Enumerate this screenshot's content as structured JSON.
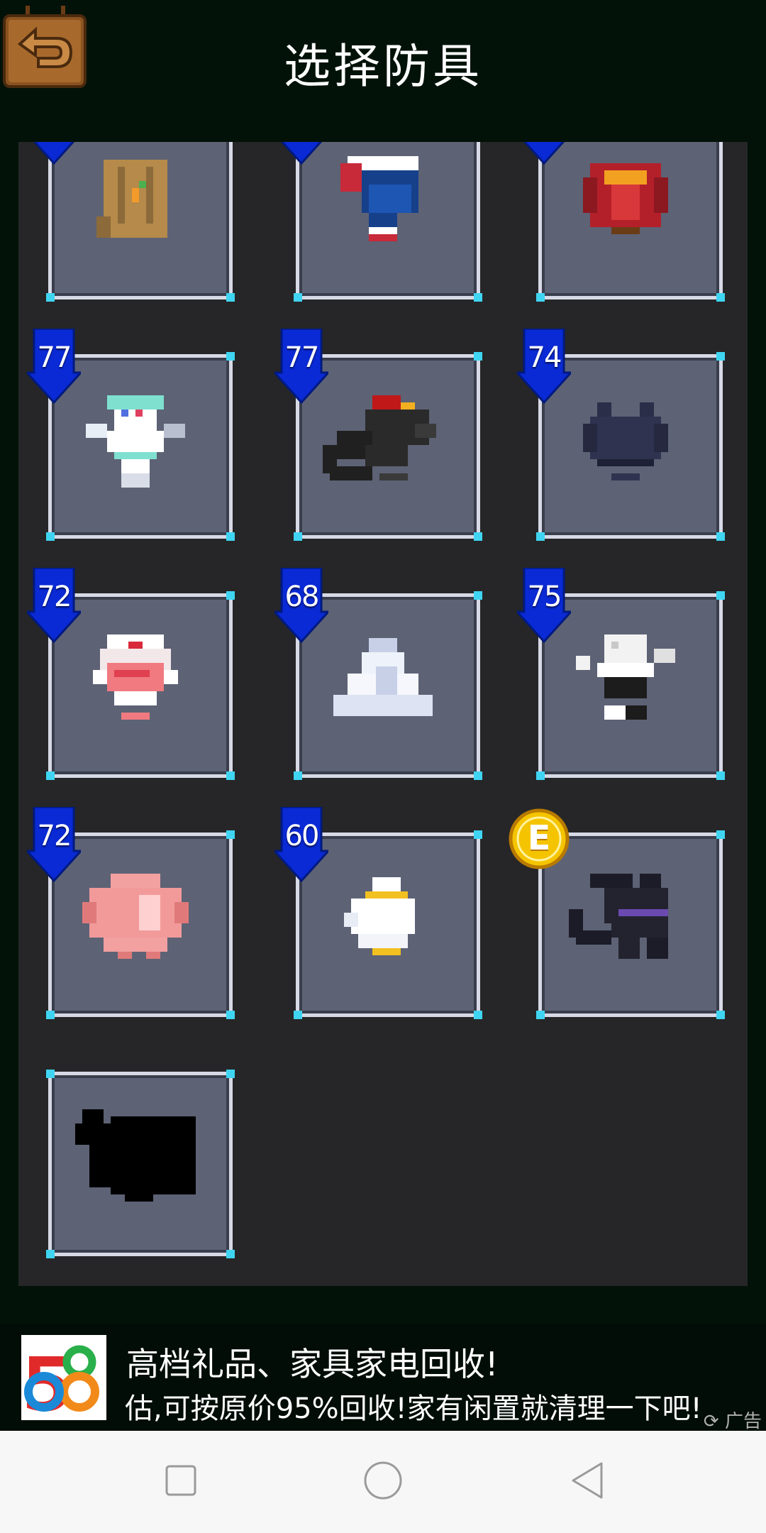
{
  "header": {
    "title": "选择防具",
    "back_icon": "back-arrow-icon"
  },
  "armors": [
    {
      "sprite": "tan-vest-armor-icon",
      "badge": ""
    },
    {
      "sprite": "blue-cape-armor-icon",
      "badge": ""
    },
    {
      "sprite": "red-mage-armor-icon",
      "badge": ""
    },
    {
      "sprite": "white-mech-armor-icon",
      "badge": "77"
    },
    {
      "sprite": "black-dragon-armor-icon",
      "badge": "77"
    },
    {
      "sprite": "dark-slime-armor-icon",
      "badge": "74"
    },
    {
      "sprite": "pink-maid-armor-icon",
      "badge": "72"
    },
    {
      "sprite": "white-snow-armor-icon",
      "badge": "68"
    },
    {
      "sprite": "white-robot-armor-icon",
      "badge": "75"
    },
    {
      "sprite": "pink-pig-armor-icon",
      "badge": "72"
    },
    {
      "sprite": "white-cloud-armor-icon",
      "badge": "60"
    },
    {
      "sprite": "dark-bat-armor-icon",
      "badge": "E"
    },
    {
      "sprite": "locked-silhouette-armor-icon",
      "badge": ""
    }
  ],
  "ad": {
    "title": "高档礼品、家具家电回收!",
    "subtitle": "估,可按原价95%回收!家有闲置就清理一下吧!",
    "tag": "广告",
    "logo_text": "58"
  },
  "navbar": {
    "recent": "square-icon",
    "home": "circle-icon",
    "back": "triangle-back-icon"
  },
  "colors": {
    "background": "#021208",
    "panel": "#262628",
    "card": "#5d6275",
    "badge": "#0a2ad6",
    "coin": "#f5c400"
  }
}
